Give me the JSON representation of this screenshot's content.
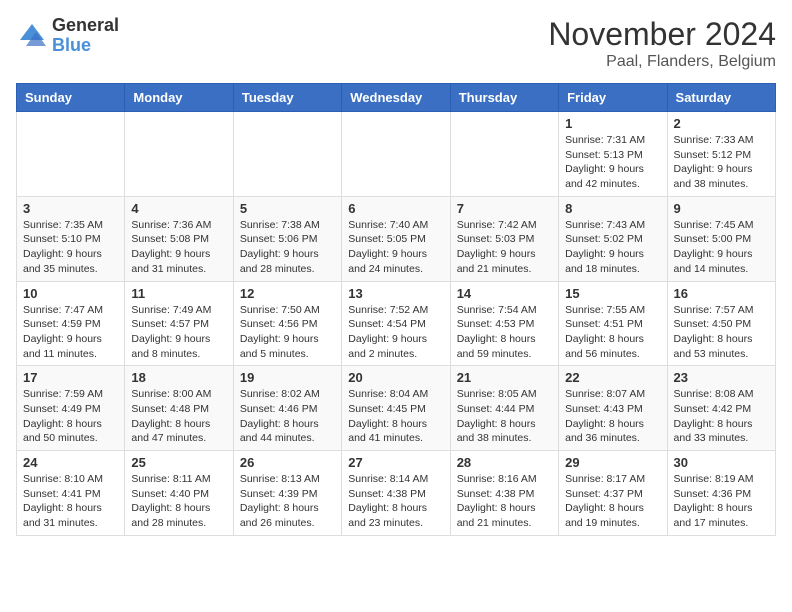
{
  "logo": {
    "general": "General",
    "blue": "Blue"
  },
  "header": {
    "title": "November 2024",
    "subtitle": "Paal, Flanders, Belgium"
  },
  "weekdays": [
    "Sunday",
    "Monday",
    "Tuesday",
    "Wednesday",
    "Thursday",
    "Friday",
    "Saturday"
  ],
  "weeks": [
    [
      {
        "day": "",
        "info": ""
      },
      {
        "day": "",
        "info": ""
      },
      {
        "day": "",
        "info": ""
      },
      {
        "day": "",
        "info": ""
      },
      {
        "day": "",
        "info": ""
      },
      {
        "day": "1",
        "info": "Sunrise: 7:31 AM\nSunset: 5:13 PM\nDaylight: 9 hours and 42 minutes."
      },
      {
        "day": "2",
        "info": "Sunrise: 7:33 AM\nSunset: 5:12 PM\nDaylight: 9 hours and 38 minutes."
      }
    ],
    [
      {
        "day": "3",
        "info": "Sunrise: 7:35 AM\nSunset: 5:10 PM\nDaylight: 9 hours and 35 minutes."
      },
      {
        "day": "4",
        "info": "Sunrise: 7:36 AM\nSunset: 5:08 PM\nDaylight: 9 hours and 31 minutes."
      },
      {
        "day": "5",
        "info": "Sunrise: 7:38 AM\nSunset: 5:06 PM\nDaylight: 9 hours and 28 minutes."
      },
      {
        "day": "6",
        "info": "Sunrise: 7:40 AM\nSunset: 5:05 PM\nDaylight: 9 hours and 24 minutes."
      },
      {
        "day": "7",
        "info": "Sunrise: 7:42 AM\nSunset: 5:03 PM\nDaylight: 9 hours and 21 minutes."
      },
      {
        "day": "8",
        "info": "Sunrise: 7:43 AM\nSunset: 5:02 PM\nDaylight: 9 hours and 18 minutes."
      },
      {
        "day": "9",
        "info": "Sunrise: 7:45 AM\nSunset: 5:00 PM\nDaylight: 9 hours and 14 minutes."
      }
    ],
    [
      {
        "day": "10",
        "info": "Sunrise: 7:47 AM\nSunset: 4:59 PM\nDaylight: 9 hours and 11 minutes."
      },
      {
        "day": "11",
        "info": "Sunrise: 7:49 AM\nSunset: 4:57 PM\nDaylight: 9 hours and 8 minutes."
      },
      {
        "day": "12",
        "info": "Sunrise: 7:50 AM\nSunset: 4:56 PM\nDaylight: 9 hours and 5 minutes."
      },
      {
        "day": "13",
        "info": "Sunrise: 7:52 AM\nSunset: 4:54 PM\nDaylight: 9 hours and 2 minutes."
      },
      {
        "day": "14",
        "info": "Sunrise: 7:54 AM\nSunset: 4:53 PM\nDaylight: 8 hours and 59 minutes."
      },
      {
        "day": "15",
        "info": "Sunrise: 7:55 AM\nSunset: 4:51 PM\nDaylight: 8 hours and 56 minutes."
      },
      {
        "day": "16",
        "info": "Sunrise: 7:57 AM\nSunset: 4:50 PM\nDaylight: 8 hours and 53 minutes."
      }
    ],
    [
      {
        "day": "17",
        "info": "Sunrise: 7:59 AM\nSunset: 4:49 PM\nDaylight: 8 hours and 50 minutes."
      },
      {
        "day": "18",
        "info": "Sunrise: 8:00 AM\nSunset: 4:48 PM\nDaylight: 8 hours and 47 minutes."
      },
      {
        "day": "19",
        "info": "Sunrise: 8:02 AM\nSunset: 4:46 PM\nDaylight: 8 hours and 44 minutes."
      },
      {
        "day": "20",
        "info": "Sunrise: 8:04 AM\nSunset: 4:45 PM\nDaylight: 8 hours and 41 minutes."
      },
      {
        "day": "21",
        "info": "Sunrise: 8:05 AM\nSunset: 4:44 PM\nDaylight: 8 hours and 38 minutes."
      },
      {
        "day": "22",
        "info": "Sunrise: 8:07 AM\nSunset: 4:43 PM\nDaylight: 8 hours and 36 minutes."
      },
      {
        "day": "23",
        "info": "Sunrise: 8:08 AM\nSunset: 4:42 PM\nDaylight: 8 hours and 33 minutes."
      }
    ],
    [
      {
        "day": "24",
        "info": "Sunrise: 8:10 AM\nSunset: 4:41 PM\nDaylight: 8 hours and 31 minutes."
      },
      {
        "day": "25",
        "info": "Sunrise: 8:11 AM\nSunset: 4:40 PM\nDaylight: 8 hours and 28 minutes."
      },
      {
        "day": "26",
        "info": "Sunrise: 8:13 AM\nSunset: 4:39 PM\nDaylight: 8 hours and 26 minutes."
      },
      {
        "day": "27",
        "info": "Sunrise: 8:14 AM\nSunset: 4:38 PM\nDaylight: 8 hours and 23 minutes."
      },
      {
        "day": "28",
        "info": "Sunrise: 8:16 AM\nSunset: 4:38 PM\nDaylight: 8 hours and 21 minutes."
      },
      {
        "day": "29",
        "info": "Sunrise: 8:17 AM\nSunset: 4:37 PM\nDaylight: 8 hours and 19 minutes."
      },
      {
        "day": "30",
        "info": "Sunrise: 8:19 AM\nSunset: 4:36 PM\nDaylight: 8 hours and 17 minutes."
      }
    ]
  ]
}
